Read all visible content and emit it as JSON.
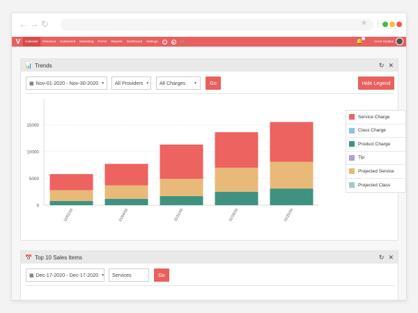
{
  "browser": {
    "back_glyph": "←",
    "forward_glyph": "→",
    "reload_glyph": "↻",
    "star_glyph": "★",
    "menu_glyph": "⋮",
    "dots": [
      "#4cb648",
      "#f4bf3a",
      "#ee5a52"
    ]
  },
  "nav": {
    "logo": "V",
    "items": [
      "Calendar",
      "Checkout",
      "Customers",
      "Marketing",
      "Forms",
      "Reports",
      "Dashboard",
      "Settings"
    ],
    "help_glyph": "?",
    "play_glyph": "▶",
    "cart_glyph": "🛒",
    "bell_glyph": "🔔",
    "notification_count": "1",
    "user_name": "Acme Studios"
  },
  "trends": {
    "icon": "📊",
    "title": "Trends",
    "refresh_glyph": "↻",
    "close_glyph": "✕",
    "date_range": "Nov-01-2020 - Nov-30-2020",
    "providers": "All Providers",
    "charges": "All Charges",
    "go_label": "Go",
    "hide_legend_label": "Hide Legend"
  },
  "top_sales": {
    "icon": "📅",
    "title": "Top 10 Sales Items",
    "refresh_glyph": "↻",
    "close_glyph": "✕",
    "date_range": "Dec-17-2020 - Dec-17-2020",
    "category": "Services",
    "go_label": "Go"
  },
  "chart_data": {
    "type": "bar",
    "stacked": true,
    "categories": [
      "11/01/16",
      "11/04/16",
      "11/11/16",
      "11/18/16",
      "11/25/16"
    ],
    "ylim": [
      0,
      17500
    ],
    "yticks": [
      0,
      5000,
      10000,
      15000
    ],
    "grid": true,
    "legend_position": "right",
    "series": [
      {
        "name": "Service Charge",
        "color": "#ec635f",
        "values": [
          3000,
          4000,
          6400,
          6600,
          7400
        ]
      },
      {
        "name": "Class Charge",
        "color": "#89c4e1",
        "values": [
          0,
          0,
          0,
          0,
          0
        ]
      },
      {
        "name": "Product Charge",
        "color": "#3f9280",
        "values": [
          800,
          1200,
          1700,
          2500,
          3100
        ]
      },
      {
        "name": "Tip",
        "color": "#b3a2c8",
        "values": [
          0,
          0,
          0,
          0,
          0
        ]
      },
      {
        "name": "Projected Service",
        "color": "#e8b979",
        "values": [
          2000,
          2500,
          3200,
          4500,
          5000
        ]
      },
      {
        "name": "Projected Class",
        "color": "#9ecbcb",
        "values": [
          0,
          0,
          0,
          0,
          0
        ]
      }
    ],
    "stack_order": [
      "Product Charge",
      "Projected Service",
      "Service Charge"
    ]
  }
}
